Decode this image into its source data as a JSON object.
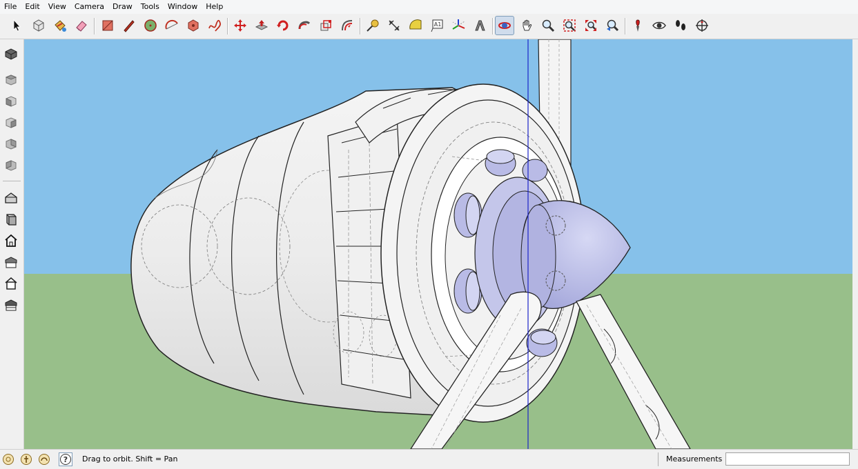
{
  "menu": [
    "File",
    "Edit",
    "View",
    "Camera",
    "Draw",
    "Tools",
    "Window",
    "Help"
  ],
  "toolbar_icons": [
    "select-arrow-icon",
    "make-component-icon",
    "paint-bucket-icon",
    "eraser-icon",
    "rectangle-icon",
    "pencil-line-icon",
    "circle-icon",
    "arc-icon",
    "polygon-icon",
    "freehand-icon",
    "move-icon",
    "push-pull-icon",
    "rotate-icon",
    "follow-me-icon",
    "scale-icon",
    "offset-icon",
    "tape-measure-icon",
    "dimension-icon",
    "protractor-icon",
    "text-icon",
    "axes-icon",
    "3d-text-icon",
    "orbit-icon",
    "pan-icon",
    "zoom-icon",
    "zoom-window-icon",
    "zoom-extents-icon",
    "previous-view-icon",
    "position-camera-icon",
    "look-around-icon",
    "walk-icon",
    "section-plane-icon"
  ],
  "left_icons": [
    "iso-view-icon",
    "top-view-icon",
    "front-view-icon",
    "right-view-icon",
    "back-view-icon",
    "left-view-icon",
    "xray-style-icon",
    "wireframe-style-icon",
    "hidden-line-style-icon",
    "shaded-style-icon",
    "textured-style-icon",
    "monochrome-style-icon"
  ],
  "status": {
    "text": "Drag to orbit.  Shift = Pan",
    "measurements_label": "Measurements",
    "measurements_value": ""
  },
  "colors": {
    "sky": "#86c1ea",
    "ground": "#98bf8a",
    "model_face": "#ececec",
    "model_blue": "#b9bbe6",
    "axis_blue": "#1a23c8"
  }
}
